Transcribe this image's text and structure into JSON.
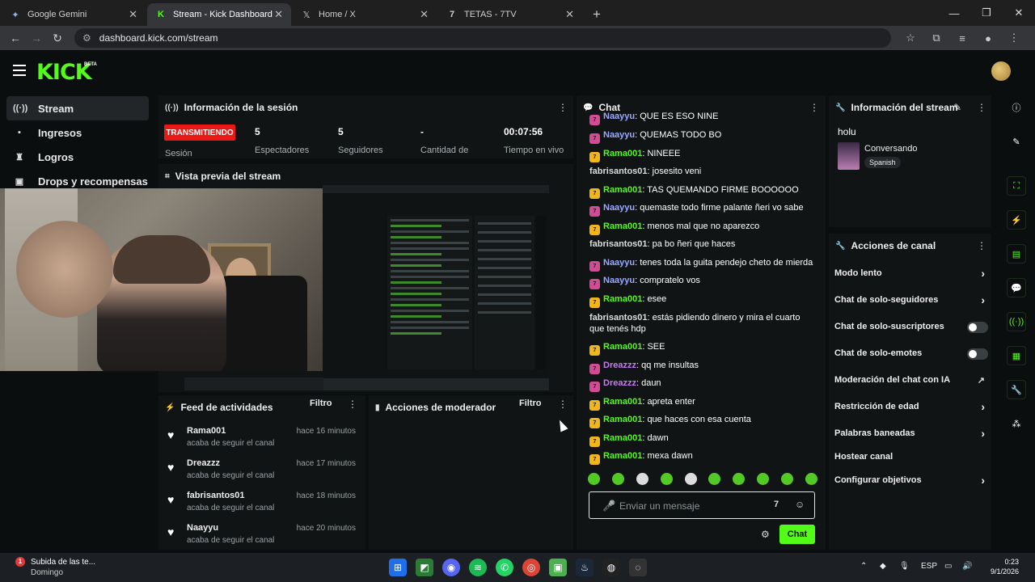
{
  "browser": {
    "tabs": [
      {
        "title": "Google Gemini",
        "icon": "gemini-icon"
      },
      {
        "title": "Stream - Kick Dashboard",
        "icon": "kick-icon"
      },
      {
        "title": "Home / X",
        "icon": "x-icon"
      },
      {
        "title": "TETAS - 7TV",
        "icon": "7tv-icon"
      }
    ],
    "url": "dashboard.kick.com/stream"
  },
  "header": {
    "logo": "KICK",
    "beta": "BETA"
  },
  "sidebar": {
    "items": [
      {
        "label": "Stream",
        "icon": "broadcast-icon"
      },
      {
        "label": "Ingresos",
        "icon": "money-icon"
      },
      {
        "label": "Logros",
        "icon": "trophy-icon"
      },
      {
        "label": "Drops y recompensas",
        "icon": "gift-icon"
      }
    ]
  },
  "session": {
    "title": "Información de la sesión",
    "status": "TRANSMITIENDO",
    "status_label": "Sesión",
    "stats": [
      {
        "value": "5",
        "label": "Espectadores"
      },
      {
        "value": "5",
        "label": "Seguidores"
      },
      {
        "value": "-",
        "label": "Cantidad de"
      },
      {
        "value": "00:07:56",
        "label": "Tiempo en vivo"
      }
    ]
  },
  "preview": {
    "title": "Vista previa del stream"
  },
  "feed": {
    "title": "Feed de actividades",
    "filter": "Filtro",
    "items": [
      {
        "name": "Rama001",
        "sub": "acaba de seguir el canal",
        "time": "hace 16 minutos"
      },
      {
        "name": "Dreazzz",
        "sub": "acaba de seguir el canal",
        "time": "hace 17 minutos"
      },
      {
        "name": "fabrisantos01",
        "sub": "acaba de seguir el canal",
        "time": "hace 18 minutos"
      },
      {
        "name": "Naayyu",
        "sub": "acaba de seguir el canal",
        "time": "hace 20 minutos"
      }
    ]
  },
  "mod": {
    "title": "Acciones de moderador",
    "filter": "Filtro"
  },
  "chat": {
    "title": "Chat",
    "messages": [
      {
        "user": "Naayyu",
        "text": ": QUE ES ESO NINE",
        "badge": "p",
        "color": "blue"
      },
      {
        "user": "Naayyu",
        "text": ": QUEMAS TODO BO",
        "badge": "p",
        "color": "blue"
      },
      {
        "user": "Rama001",
        "text": ": NINEEE",
        "badge": "y",
        "color": "green"
      },
      {
        "user": "fabrisantos01",
        "text": ": josesito veni",
        "badge": "",
        "color": "white"
      },
      {
        "user": "Rama001",
        "text": ": TAS QUEMANDO FIRME BOOOOOO",
        "badge": "y",
        "color": "green"
      },
      {
        "user": "Naayyu",
        "text": ": quemaste todo firme palante ñeri vo sabe",
        "badge": "p",
        "color": "blue"
      },
      {
        "user": "Rama001",
        "text": ": menos mal que no aparezco",
        "badge": "y",
        "color": "green"
      },
      {
        "user": "fabrisantos01",
        "text": ": pa bo ñeri que haces",
        "badge": "",
        "color": "white"
      },
      {
        "user": "Naayyu",
        "text": ": tenes toda la guita pendejo cheto de mierda",
        "badge": "p",
        "color": "blue"
      },
      {
        "user": "Naayyu",
        "text": ": compratelo vos",
        "badge": "p",
        "color": "blue"
      },
      {
        "user": "Rama001",
        "text": ": esee",
        "badge": "y",
        "color": "green"
      },
      {
        "user": "fabrisantos01",
        "text": ": estás pidiendo dinero y mira el cuarto que tenés hdp",
        "badge": "",
        "color": "white"
      },
      {
        "user": "Rama001",
        "text": ": SEE",
        "badge": "y",
        "color": "green"
      },
      {
        "user": "Dreazzz",
        "text": ": qq me insultas",
        "badge": "p",
        "color": "purple"
      },
      {
        "user": "Dreazzz",
        "text": ": daun",
        "badge": "p",
        "color": "purple"
      },
      {
        "user": "Rama001",
        "text": ": apreta enter",
        "badge": "y",
        "color": "green"
      },
      {
        "user": "Rama001",
        "text": ": que haces con esa cuenta",
        "badge": "y",
        "color": "green"
      },
      {
        "user": "Rama001",
        "text": ": dawn",
        "badge": "y",
        "color": "green"
      },
      {
        "user": "Rama001",
        "text": ": mexa dawn",
        "badge": "y",
        "color": "green"
      }
    ],
    "placeholder": "Enviar un mensaje",
    "send": "Chat"
  },
  "stream_info": {
    "title": "Información del stream",
    "stream_title": "holu",
    "category": "Conversando",
    "language": "Spanish"
  },
  "channel_actions": {
    "title": "Acciones de canal",
    "items": [
      {
        "label": "Modo lento",
        "type": "chevron"
      },
      {
        "label": "Chat de solo-seguidores",
        "type": "chevron"
      },
      {
        "label": "Chat de solo-suscriptores",
        "type": "toggle"
      },
      {
        "label": "Chat de solo-emotes",
        "type": "toggle"
      },
      {
        "label": "Moderación del chat con IA",
        "type": "external"
      },
      {
        "label": "Restricción de edad",
        "type": "chevron"
      },
      {
        "label": "Palabras baneadas",
        "type": "chevron"
      },
      {
        "label": "Hostear canal",
        "type": "none"
      },
      {
        "label": "Configurar objetivos",
        "type": "chevron"
      }
    ]
  },
  "taskbar": {
    "notif_count": "1",
    "notif_title": "Subida de las te...",
    "notif_sub": "Domingo",
    "lang": "ESP",
    "time": "0:23",
    "date": "9/1/2026"
  },
  "colors": {
    "kick_green": "#53fc18",
    "live_red": "#e91916",
    "panel_bg": "#111415"
  }
}
